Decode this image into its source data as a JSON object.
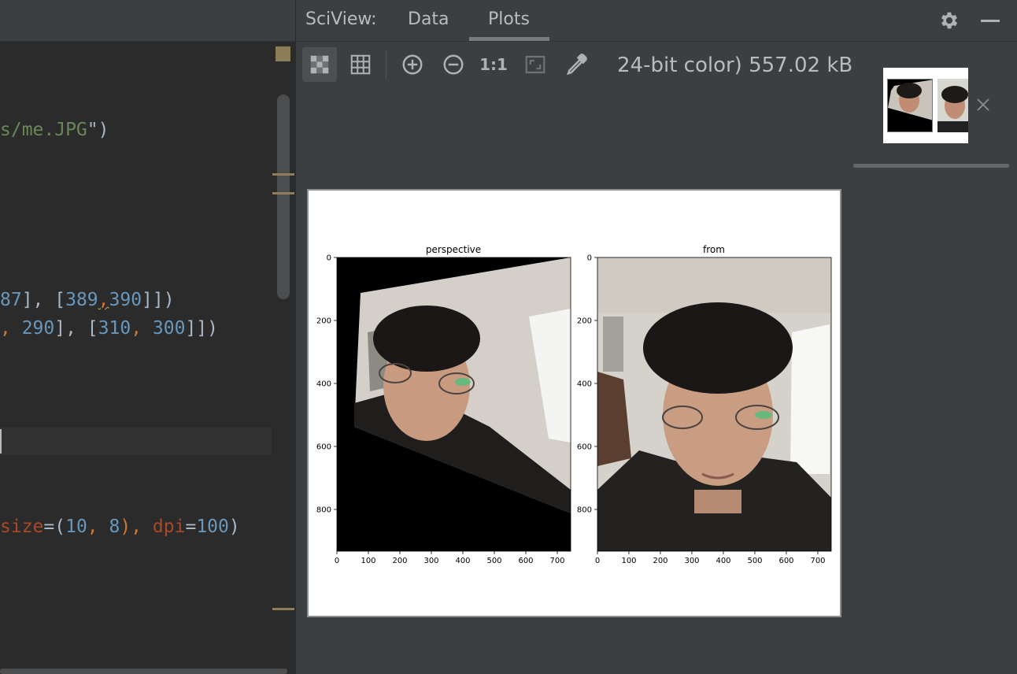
{
  "sciview": {
    "title": "SciView:",
    "tabs": [
      {
        "label": "Data",
        "selected": false
      },
      {
        "label": "Plots",
        "selected": true
      }
    ],
    "image_info": "24-bit color) 557.02 kB",
    "toolbar": {
      "ratio_label": "1:1",
      "buttons": [
        "chessboard-icon",
        "grid-icon",
        "zoom-in-icon",
        "zoom-out-icon",
        "actual-size",
        "fit-zoom-icon",
        "color-picker-icon"
      ],
      "active": "chessboard-icon"
    },
    "thumbnails": {
      "count": 2
    }
  },
  "editor": {
    "lines": [
      [
        {
          "t": "s/me.JPG",
          "c": "s-str"
        },
        {
          "t": "\")",
          "c": "s-default"
        }
      ],
      [
        {
          "t": "87",
          "c": "s-num"
        },
        {
          "t": "], [",
          "c": "s-default"
        },
        {
          "t": "389",
          "c": "s-num"
        },
        {
          "t": ",",
          "c": "s-squig"
        },
        {
          "t": "390",
          "c": "s-num"
        },
        {
          "t": "]])",
          "c": "s-default"
        }
      ],
      [
        {
          "t": ", ",
          "c": "s-kw"
        },
        {
          "t": "290",
          "c": "s-num"
        },
        {
          "t": "], [",
          "c": "s-default"
        },
        {
          "t": "310",
          "c": "s-num"
        },
        {
          "t": ", ",
          "c": "s-kw"
        },
        {
          "t": "300",
          "c": "s-num"
        },
        {
          "t": "]])",
          "c": "s-default"
        }
      ],
      [
        {
          "t": "size",
          "c": "s-par"
        },
        {
          "t": "=(",
          "c": "s-default"
        },
        {
          "t": "10",
          "c": "s-num"
        },
        {
          "t": ", ",
          "c": "s-kw"
        },
        {
          "t": "8",
          "c": "s-num"
        },
        {
          "t": "), ",
          "c": "s-kw"
        },
        {
          "t": "dpi",
          "c": "s-par"
        },
        {
          "t": "=",
          "c": "s-default"
        },
        {
          "t": "100",
          "c": "s-num"
        },
        {
          "t": ")",
          "c": "s-default"
        }
      ]
    ]
  },
  "plot": {
    "subplots": [
      {
        "title": "perspective",
        "x_ticks": [
          "0",
          "100",
          "200",
          "300",
          "400",
          "500",
          "600",
          "700"
        ],
        "y_ticks": [
          "0",
          "200",
          "400",
          "600",
          "800"
        ]
      },
      {
        "title": "from",
        "x_ticks": [
          "0",
          "100",
          "200",
          "300",
          "400",
          "500",
          "600",
          "700"
        ],
        "y_ticks": [
          "0",
          "200",
          "400",
          "600",
          "800"
        ]
      }
    ]
  },
  "colors": {
    "editor_bg": "#2b2b2b",
    "panel_bg": "#3c3f41",
    "string": "#6a8759",
    "number": "#6897bb",
    "keyword": "#cc7832",
    "param": "#aa4926"
  }
}
